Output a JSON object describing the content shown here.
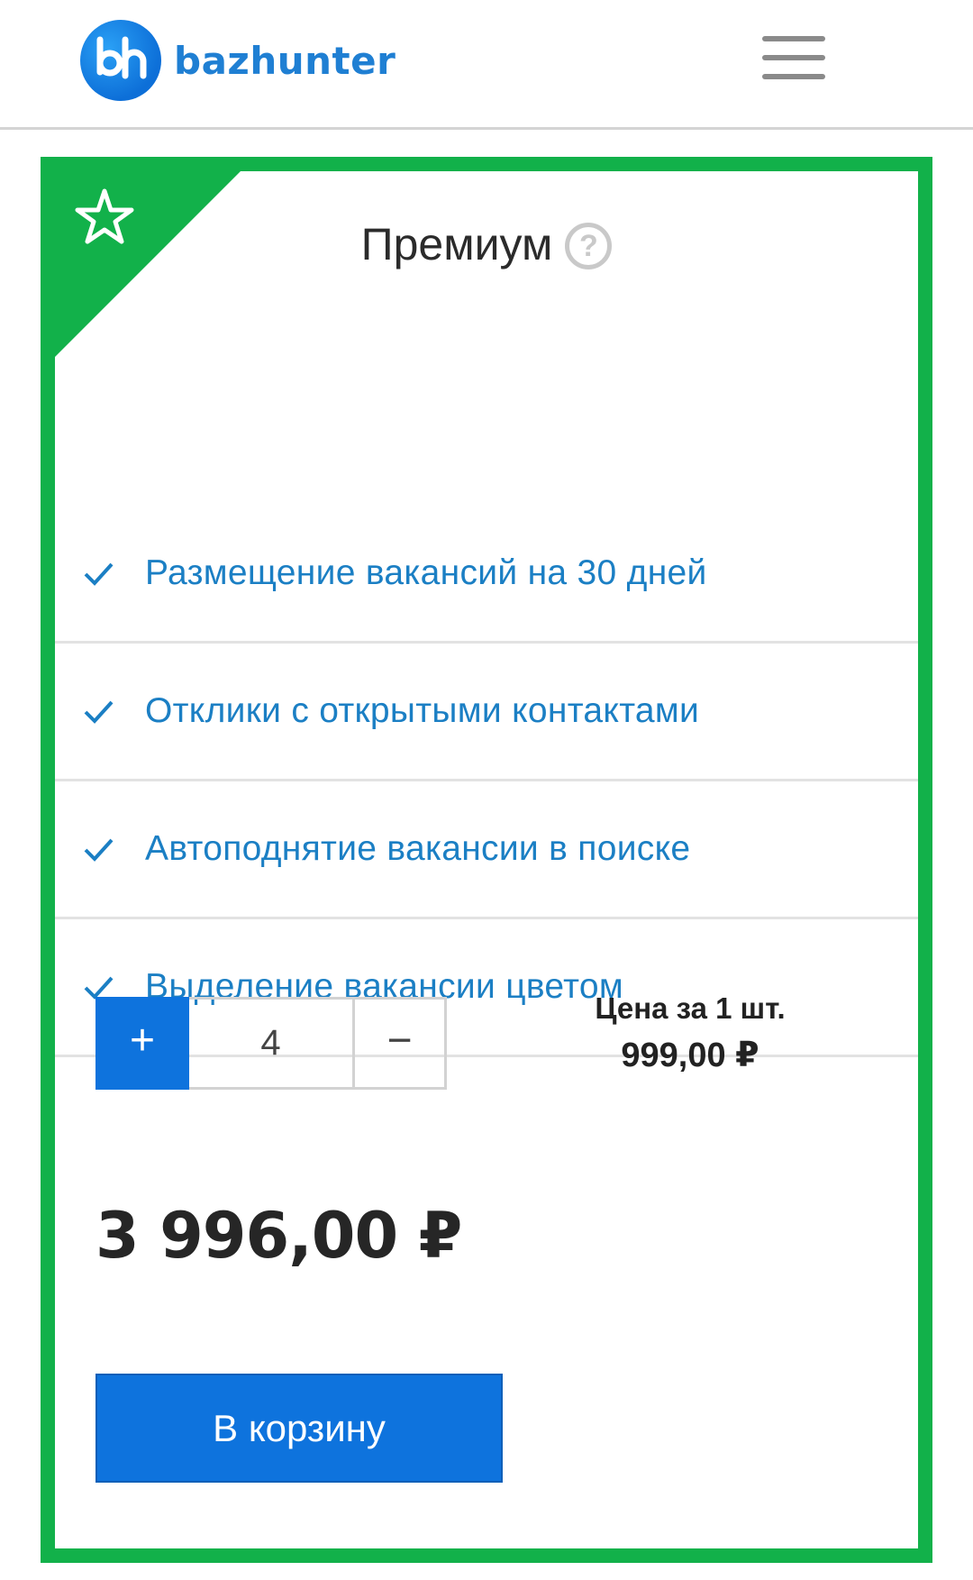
{
  "header": {
    "logo_text": "bazhunter",
    "logo_mark": "bh"
  },
  "card": {
    "title": "Премиум",
    "help_glyph": "?",
    "badge_icon": "star-outline-icon",
    "features": [
      {
        "label": "Размещение вакансий на 30 дней"
      },
      {
        "label": "Отклики с открытыми контактами"
      },
      {
        "label": "Автоподнятие вакансии в поиске"
      },
      {
        "label": "Выделение вакансии цветом"
      }
    ],
    "quantity": {
      "plus_label": "+",
      "value": "4",
      "minus_label": "−"
    },
    "unit_price": {
      "label": "Цена за 1 шт.",
      "value": "999,00 ₽"
    },
    "total": "3 996,00 ₽",
    "cart_button": "В корзину"
  },
  "colors": {
    "card_border": "#12b14a",
    "accent_blue": "#0e73dd",
    "feature_text": "#1b7fc4"
  }
}
